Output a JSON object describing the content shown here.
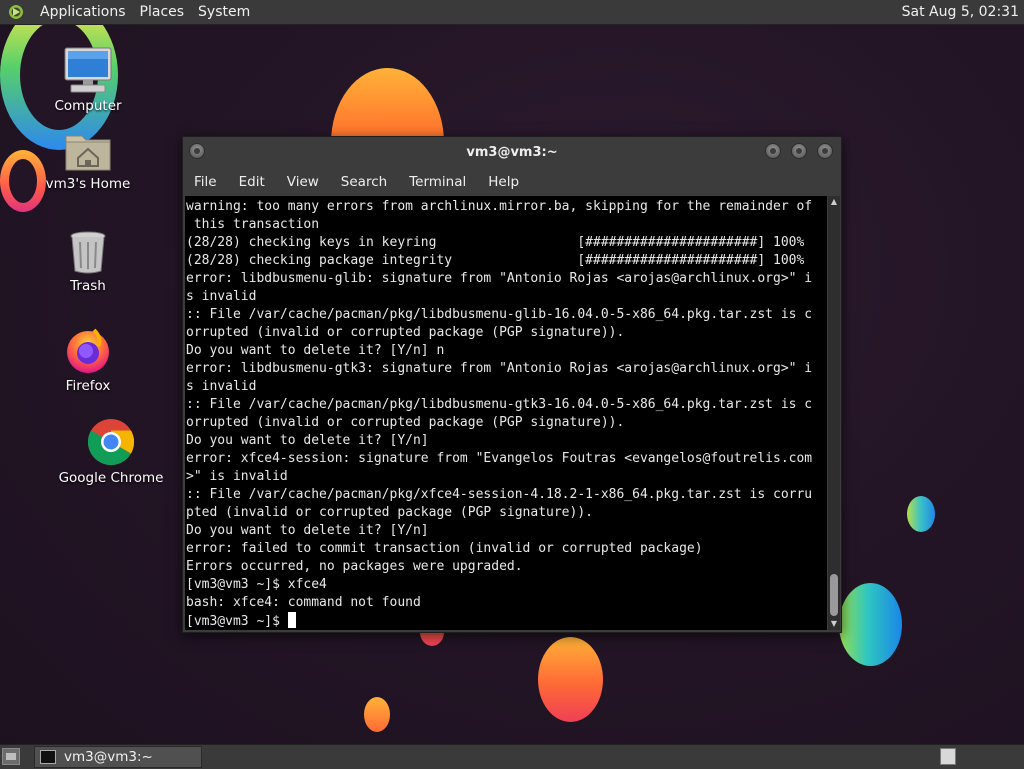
{
  "top_panel": {
    "menus": [
      "Applications",
      "Places",
      "System"
    ],
    "clock": "Sat Aug  5, 02:31"
  },
  "desktop_icons": [
    {
      "label": "Computer",
      "icon": "computer-icon"
    },
    {
      "label": "vm3's Home",
      "icon": "home-folder-icon"
    },
    {
      "label": "Trash",
      "icon": "trash-icon"
    },
    {
      "label": "Firefox",
      "icon": "firefox-icon"
    },
    {
      "label": "Google Chrome",
      "icon": "chrome-icon"
    }
  ],
  "terminal": {
    "title": "vm3@vm3:~",
    "menus": [
      "File",
      "Edit",
      "View",
      "Search",
      "Terminal",
      "Help"
    ],
    "lines": [
      "warning: too many errors from archlinux.mirror.ba, skipping for the remainder of",
      " this transaction",
      "(28/28) checking keys in keyring                  [######################] 100%",
      "(28/28) checking package integrity                [######################] 100%",
      "error: libdbusmenu-glib: signature from \"Antonio Rojas <arojas@archlinux.org>\" i",
      "s invalid",
      ":: File /var/cache/pacman/pkg/libdbusmenu-glib-16.04.0-5-x86_64.pkg.tar.zst is c",
      "orrupted (invalid or corrupted package (PGP signature)).",
      "Do you want to delete it? [Y/n] n",
      "error: libdbusmenu-gtk3: signature from \"Antonio Rojas <arojas@archlinux.org>\" i",
      "s invalid",
      ":: File /var/cache/pacman/pkg/libdbusmenu-gtk3-16.04.0-5-x86_64.pkg.tar.zst is c",
      "orrupted (invalid or corrupted package (PGP signature)).",
      "Do you want to delete it? [Y/n]",
      "error: xfce4-session: signature from \"Evangelos Foutras <evangelos@foutrelis.com",
      ">\" is invalid",
      ":: File /var/cache/pacman/pkg/xfce4-session-4.18.2-1-x86_64.pkg.tar.zst is corru",
      "pted (invalid or corrupted package (PGP signature)).",
      "Do you want to delete it? [Y/n]",
      "error: failed to commit transaction (invalid or corrupted package)",
      "Errors occurred, no packages were upgraded.",
      "[vm3@vm3 ~]$ xfce4",
      "bash: xfce4: command not found"
    ],
    "prompt": "[vm3@vm3 ~]$ "
  },
  "bottom_panel": {
    "task_label": "vm3@vm3:~"
  },
  "colors": {
    "panel": "#3a3a3a",
    "terminal_bg": "#000000",
    "terminal_fg": "#e8e8e8",
    "desktop_bg": "#241526"
  }
}
